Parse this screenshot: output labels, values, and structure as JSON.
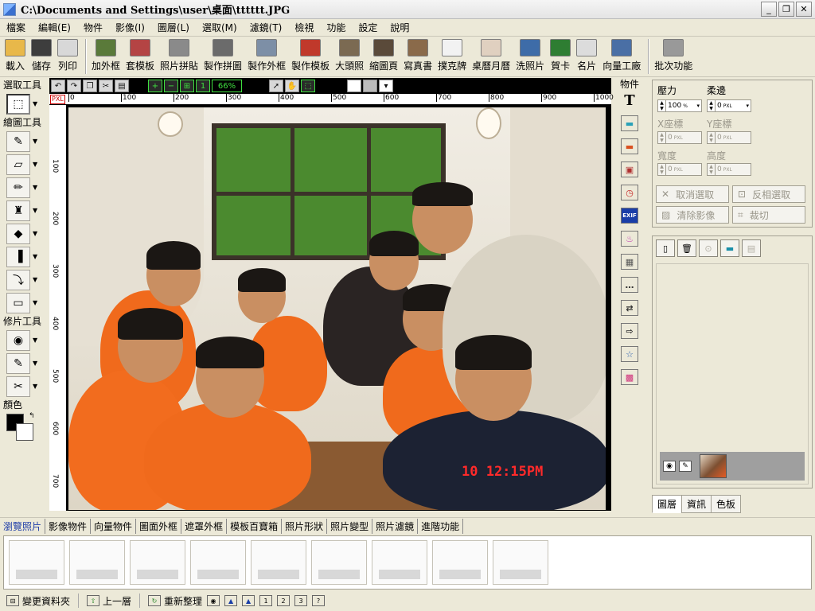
{
  "window": {
    "title": "C:\\Documents and Settings\\user\\桌面\\tttttt.JPG",
    "minimize": "_",
    "maximize": "❐",
    "close": "✕"
  },
  "menu": [
    "檔案",
    "編輯(E)",
    "物件",
    "影像(I)",
    "圖層(L)",
    "選取(M)",
    "濾鏡(T)",
    "檢視",
    "功能",
    "設定",
    "說明"
  ],
  "toolbar": [
    {
      "label": "載入",
      "icon": "open-folder-icon",
      "color": "#e8b84a"
    },
    {
      "label": "儲存",
      "icon": "floppy-icon",
      "color": "#3d3d3d"
    },
    {
      "label": "列印",
      "icon": "printer-icon",
      "color": "#d8d8d8"
    },
    {
      "label": "加外框",
      "icon": "frame-icon",
      "color": "#5a7a3a"
    },
    {
      "label": "套模板",
      "icon": "template-icon",
      "color": "#b44444"
    },
    {
      "label": "照片拼貼",
      "icon": "collage-icon",
      "color": "#8a8a8a"
    },
    {
      "label": "製作拼圖",
      "icon": "puzzle-icon",
      "color": "#6b6b6b"
    },
    {
      "label": "製作外框",
      "icon": "make-frame-icon",
      "color": "#7d8fa6"
    },
    {
      "label": "製作模板",
      "icon": "make-template-icon",
      "color": "#c0392b"
    },
    {
      "label": "大頭照",
      "icon": "id-photo-icon",
      "color": "#7b6a52"
    },
    {
      "label": "縮圖頁",
      "icon": "thumbnail-page-icon",
      "color": "#5a4a3a"
    },
    {
      "label": "寫真書",
      "icon": "photo-book-icon",
      "color": "#8a6a4a"
    },
    {
      "label": "撲克牌",
      "icon": "playing-cards-icon",
      "color": "#f2f2f2"
    },
    {
      "label": "桌曆月曆",
      "icon": "calendar-icon",
      "color": "#e0d0c0"
    },
    {
      "label": "洗照片",
      "icon": "print-photo-icon",
      "color": "#3e6ca8"
    },
    {
      "label": "賀卡",
      "icon": "greeting-card-icon",
      "color": "#2e7d32"
    },
    {
      "label": "名片",
      "icon": "business-card-icon",
      "color": "#dcdcdc"
    },
    {
      "label": "向量工廠",
      "icon": "vector-factory-icon",
      "color": "#4a6fa5"
    },
    {
      "label": "批次功能",
      "icon": "batch-icon",
      "color": "#999999"
    }
  ],
  "left": {
    "select_title": "選取工具",
    "draw_title": "繪圖工具",
    "retouch_title": "修片工具",
    "color_title": "顏色",
    "select_tools": [
      {
        "icon": "marquee-icon",
        "glyph": "⬚"
      }
    ],
    "draw_tools": [
      {
        "icon": "brush-icon",
        "glyph": "✎"
      },
      {
        "icon": "eraser-icon",
        "glyph": "▱"
      },
      {
        "icon": "pencil-icon",
        "glyph": "✏"
      },
      {
        "icon": "stamp-icon",
        "glyph": "♜"
      },
      {
        "icon": "fill-bucket-icon",
        "glyph": "◆"
      },
      {
        "icon": "gradient-icon",
        "glyph": "▐"
      },
      {
        "icon": "eyedropper-icon",
        "glyph": "⤵"
      },
      {
        "icon": "rectangle-icon",
        "glyph": "▭"
      }
    ],
    "retouch_tools": [
      {
        "icon": "red-eye-icon",
        "glyph": "◉"
      },
      {
        "icon": "retouch-brush-icon",
        "glyph": "✎"
      },
      {
        "icon": "cut-person-icon",
        "glyph": "✂"
      }
    ]
  },
  "canvas": {
    "zoom": "66%",
    "unit": "PXL",
    "hticks": [
      "0",
      "100",
      "200",
      "300",
      "400",
      "500",
      "600",
      "700",
      "800",
      "900",
      "1000"
    ],
    "vticks": [
      "100",
      "200",
      "300",
      "400",
      "500",
      "600",
      "700"
    ],
    "photo_stamp": "10  12:15PM"
  },
  "objects": {
    "title": "物件",
    "items": [
      {
        "icon": "text-icon",
        "glyph": "T",
        "color": "#000000"
      },
      {
        "icon": "image-icon",
        "glyph": "▬",
        "color": "#2aa1b8"
      },
      {
        "icon": "picture-icon",
        "glyph": "▬",
        "color": "#d9501f"
      },
      {
        "icon": "layered-image-icon",
        "glyph": "▣",
        "color": "#b03030"
      },
      {
        "icon": "clock-icon",
        "glyph": "◷",
        "color": "#c62828"
      },
      {
        "icon": "exif-icon",
        "glyph": "EXIF",
        "color": "#1a3ea8"
      },
      {
        "icon": "cake-icon",
        "glyph": "♨",
        "color": "#c23fb1"
      },
      {
        "icon": "calendar-object-icon",
        "glyph": "▦",
        "color": "#555555"
      },
      {
        "icon": "speech-bubble-icon",
        "glyph": "…",
        "color": "#333333"
      },
      {
        "icon": "double-arrow-icon",
        "glyph": "⇄",
        "color": "#333333"
      },
      {
        "icon": "arrow-icon",
        "glyph": "⇨",
        "color": "#333333"
      },
      {
        "icon": "star-icon",
        "glyph": "☆",
        "color": "#2a5fb0"
      },
      {
        "icon": "mosaic-icon",
        "glyph": "▩",
        "color": "#d0307a"
      }
    ]
  },
  "props": {
    "pressure_label": "壓力",
    "soften_label": "柔邊",
    "pressure_value": "100",
    "pressure_unit": "%",
    "soften_value": "0",
    "x_label": "X座標",
    "y_label": "Y座標",
    "x_value": "0",
    "y_value": "0",
    "width_label": "寬度",
    "height_label": "高度",
    "width_value": "0",
    "height_value": "0",
    "unit": "PXL",
    "cancel_select": "取消選取",
    "invert_select": "反相選取",
    "clear_image": "清除影像",
    "crop": "裁切"
  },
  "layer_tabs": [
    "圖層",
    "資訊",
    "色板"
  ],
  "bottom_tabs": [
    "瀏覽照片",
    "影像物件",
    "向量物件",
    "圖面外框",
    "遮罩外框",
    "模板百寶箱",
    "照片形狀",
    "照片變型",
    "照片濾鏡",
    "進階功能"
  ],
  "thumbnails": 9,
  "statusbar": {
    "change_folder": "變更資料夾",
    "up_level": "上一層",
    "refresh": "重新整理",
    "help": "?"
  }
}
